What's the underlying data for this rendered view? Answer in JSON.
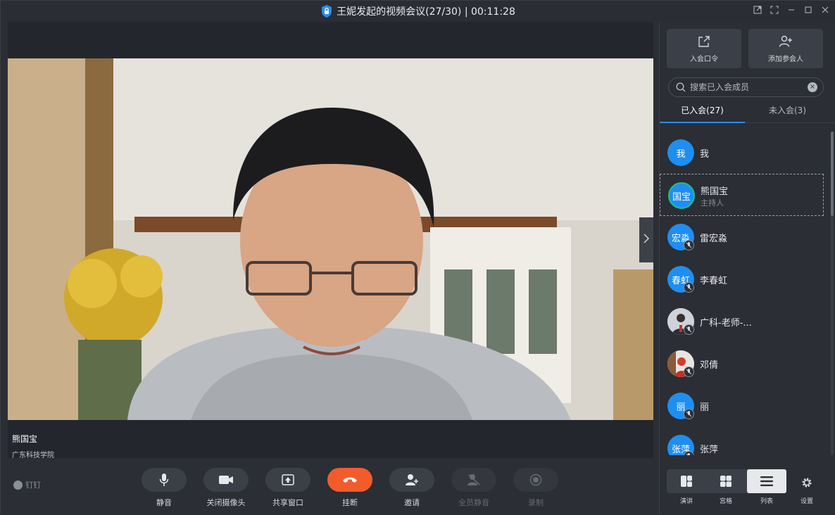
{
  "titlebar": {
    "title": "王妮发起的视频会议(27/30) | 00:11:28"
  },
  "video": {
    "speaker_name": "熊国宝",
    "speaker_org": "广东科技学院"
  },
  "brand": {
    "label": "钉钉"
  },
  "toolbar": {
    "mute": "静音",
    "camera_off": "关闭摄像头",
    "share": "共享窗口",
    "hangup": "挂断",
    "invite": "邀请",
    "mute_all": "全员静音",
    "record": "录制"
  },
  "panel": {
    "meeting_code": "入会口令",
    "add_participant": "添加参会人",
    "search_placeholder": "搜索已入会成员",
    "tab_joined": "已入会(27)",
    "tab_not_joined": "未入会(3)",
    "participants": [
      {
        "avatar": "我",
        "name": "我",
        "role": ""
      },
      {
        "avatar": "国宝",
        "name": "熊国宝",
        "role": "主持人"
      },
      {
        "avatar": "宏淼",
        "name": "雷宏淼",
        "role": ""
      },
      {
        "avatar": "春虹",
        "name": "李春虹",
        "role": ""
      },
      {
        "avatar": "",
        "name": "广科-老师-...",
        "role": ""
      },
      {
        "avatar": "",
        "name": "邓倩",
        "role": ""
      },
      {
        "avatar": "丽",
        "name": "丽",
        "role": ""
      },
      {
        "avatar": "张萍",
        "name": "张萍",
        "role": ""
      }
    ],
    "views": {
      "speaker": "演讲",
      "grid": "宫格",
      "list": "列表"
    },
    "settings": "设置"
  },
  "colors": {
    "accent": "#2a8cf0",
    "hangup": "#f25c2c",
    "avatar": "#1f8ef1",
    "host_ring": "#1fc08b"
  }
}
